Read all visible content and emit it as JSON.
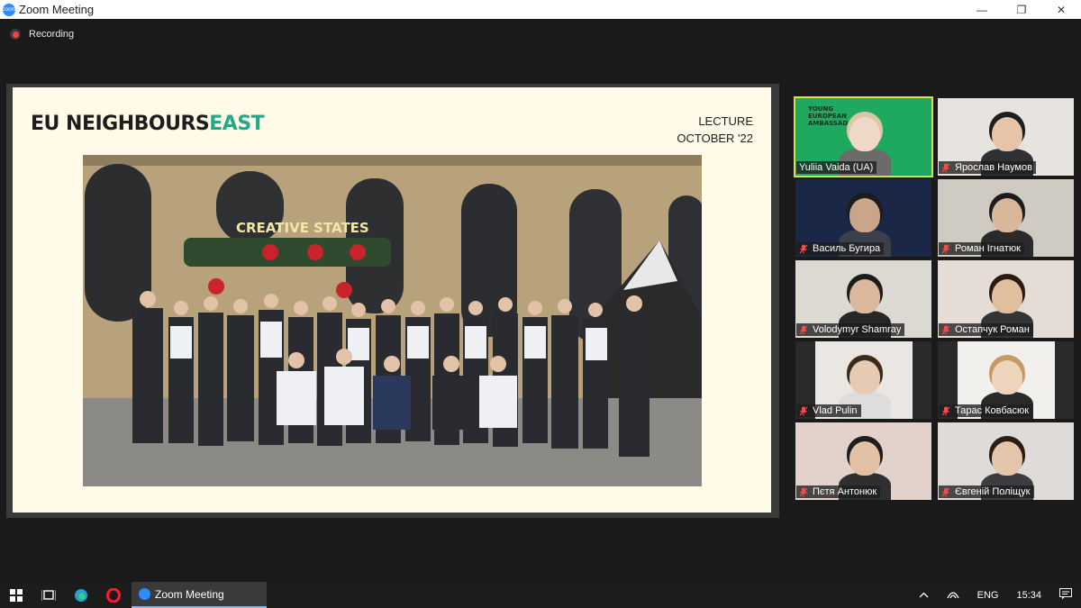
{
  "window": {
    "title": "Zoom Meeting",
    "app_icon_label": "zoom",
    "minimize_glyph": "—",
    "maximize_glyph": "❐",
    "close_glyph": "✕"
  },
  "recording": {
    "label": "Recording"
  },
  "slide": {
    "logo_main": "EU NEIGHBOURS",
    "logo_accent": "EAST",
    "meta_line1": "LECTURE",
    "meta_line2": "OCTOBER '22",
    "photo_sign": "CREATIVE STATES"
  },
  "participants": [
    {
      "name": "Yuliia Vaida (UA)",
      "muted": false,
      "active": true,
      "banner": "YOUNG EUROPEAN AMBASSADORS"
    },
    {
      "name": "Ярослав Наумов",
      "muted": true
    },
    {
      "name": "Василь Бугира",
      "muted": true
    },
    {
      "name": "Роман Ігнатюк",
      "muted": true
    },
    {
      "name": "Volodymyr Shamray",
      "muted": true
    },
    {
      "name": "Остапчук Роман",
      "muted": true
    },
    {
      "name": "Vlad Pulin",
      "muted": true
    },
    {
      "name": "Тарас Ковбасюк",
      "muted": true
    },
    {
      "name": "Пєтя Антонюк",
      "muted": true
    },
    {
      "name": "Євгеній Поліщук",
      "muted": true
    }
  ],
  "taskbar": {
    "zoom_label": "Zoom Meeting",
    "language": "ENG",
    "time": "15:34"
  },
  "colors": {
    "accent_yellow": "#d2e345",
    "zoom_blue": "#2d8cff",
    "slide_bg": "#fffbe8",
    "logo_green": "#24a88a"
  }
}
